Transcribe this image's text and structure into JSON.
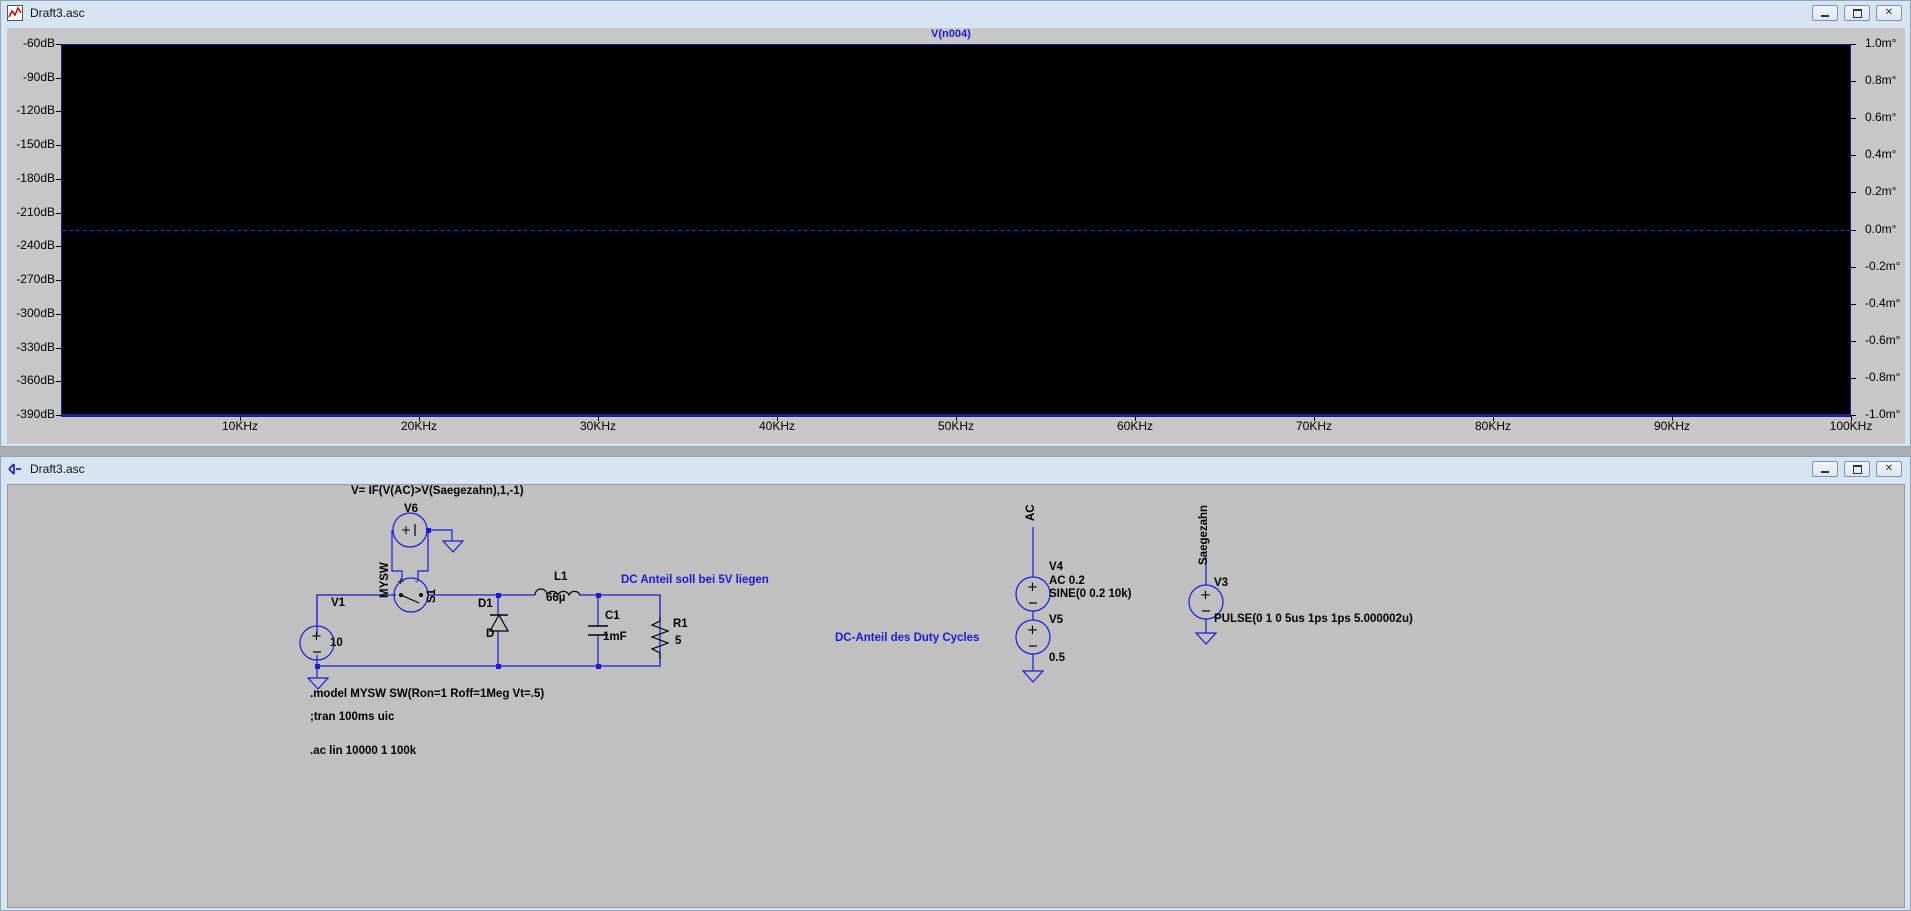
{
  "plot_window": {
    "title": "Draft3.asc",
    "trace_label": "V(n004)",
    "y_left_ticks": [
      "-60dB",
      "-90dB",
      "-120dB",
      "-150dB",
      "-180dB",
      "-210dB",
      "-240dB",
      "-270dB",
      "-300dB",
      "-330dB",
      "-360dB",
      "-390dB"
    ],
    "y_right_ticks": [
      "1.0m°",
      "0.8m°",
      "0.6m°",
      "0.4m°",
      "0.2m°",
      "0.0m°",
      "-0.2m°",
      "-0.4m°",
      "-0.6m°",
      "-0.8m°",
      "-1.0m°"
    ],
    "x_ticks": [
      "10KHz",
      "20KHz",
      "30KHz",
      "40KHz",
      "50KHz",
      "60KHz",
      "70KHz",
      "80KHz",
      "90KHz",
      "100KHz"
    ]
  },
  "chart_data": {
    "type": "line",
    "xlabel": "",
    "ylabel": "",
    "xlim": [
      0,
      100000
    ],
    "ylim": [
      -390,
      -60
    ],
    "y2lim": [
      -1.0,
      1.0
    ],
    "grid": false,
    "series": [
      {
        "name": "V(n004)",
        "axis": "right",
        "x": [
          0,
          100000
        ],
        "values": [
          0.0,
          0.0
        ]
      }
    ]
  },
  "schematic_window": {
    "title": "Draft3.asc",
    "components": {
      "V6": {
        "name": "V6",
        "expr": "V= IF(V(AC)>V(Saegezahn),1,-1)"
      },
      "V1": {
        "name": "V1",
        "value": "10"
      },
      "S1": {
        "name": "S1",
        "model": "MYSW"
      },
      "D1": {
        "name": "D1",
        "value": "D"
      },
      "L1": {
        "name": "L1",
        "value": "66µ"
      },
      "C1": {
        "name": "C1",
        "value": "1mF"
      },
      "R1": {
        "name": "R1",
        "value": "5"
      },
      "V4": {
        "name": "V4",
        "value1": "AC 0.2",
        "value2": "SINE(0 0.2 10k)"
      },
      "V5": {
        "name": "V5",
        "value": "0.5"
      },
      "V3": {
        "name": "V3",
        "value": "PULSE(0 1 0 5us 1ps 1ps 5.000002u)"
      }
    },
    "net_labels": {
      "ac": "AC",
      "saegezahn": "Saegezahn"
    },
    "comments": {
      "dc_anteil": "DC Anteil soll bei 5V liegen",
      "duty": "DC-Anteil des Duty Cycles"
    },
    "directives": {
      "model": ".model MYSW SW(Ron=1 Roff=1Meg Vt=.5)",
      "tran": ";tran 100ms uic",
      "ac": ".ac lin 10000 1 100k"
    }
  },
  "colors": {
    "wire": "#1a1ad8",
    "plot_bg": "#000000",
    "schematic_bg": "#c0c0c0"
  }
}
